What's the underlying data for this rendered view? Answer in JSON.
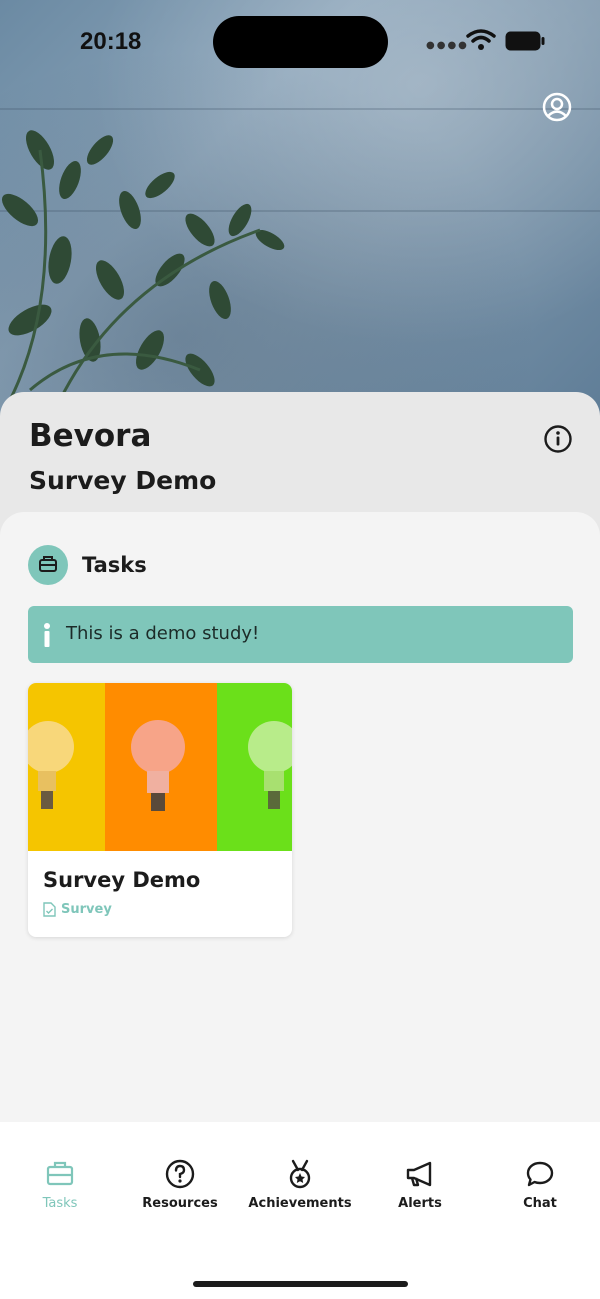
{
  "status_bar": {
    "time": "20:18"
  },
  "header": {
    "title": "Bevora",
    "subtitle": "Survey Demo"
  },
  "tasks_section": {
    "title": "Tasks",
    "banner_text": "This is a demo study!",
    "cards": [
      {
        "title": "Survey Demo",
        "type": "Survey"
      }
    ]
  },
  "tab_bar": {
    "items": [
      {
        "label": "Tasks",
        "icon": "briefcase-icon",
        "active": true
      },
      {
        "label": "Resources",
        "icon": "question-circle-icon",
        "active": false
      },
      {
        "label": "Achievements",
        "icon": "medal-icon",
        "active": false
      },
      {
        "label": "Alerts",
        "icon": "megaphone-icon",
        "active": false
      },
      {
        "label": "Chat",
        "icon": "chat-bubble-icon",
        "active": false
      }
    ]
  },
  "colors": {
    "accent": "#7fc6ba",
    "text": "#1c1c1c",
    "panel": "#e8e8e8",
    "content_bg": "#f4f4f4"
  }
}
